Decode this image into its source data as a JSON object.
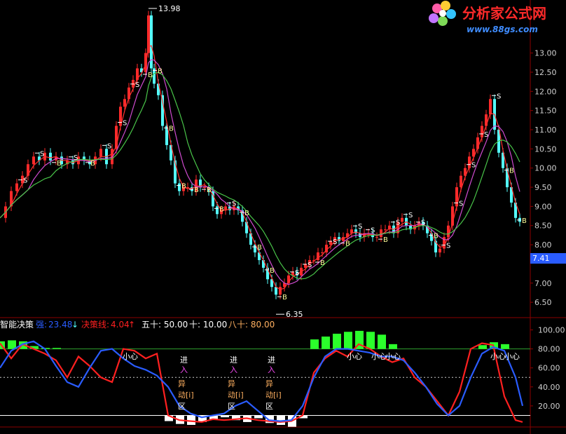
{
  "logo": {
    "name": "分析家公式网",
    "url": "www.88gs.com"
  },
  "colors": {
    "background": "#000000",
    "axis": "#8b0000",
    "up": "#ff2a2a",
    "down": "#54ffff",
    "ma_fast": "#ff3030",
    "ma_mid": "#d04bd0",
    "ma_slow": "#49c449",
    "osc_red": "#ff2020",
    "osc_blue": "#2a5cff",
    "hist_green": "#2bff2b",
    "label_yellow": "#ffff9a",
    "label_white": "#ffffff",
    "text_orange": "#ffb060",
    "text_pink": "#ff4cff"
  },
  "price_axis": {
    "ticks": [
      "13.00",
      "12.50",
      "12.00",
      "11.50",
      "11.00",
      "10.50",
      "10.00",
      "9.50",
      "9.00",
      "8.50",
      "8.00",
      "7.00",
      "6.50"
    ],
    "current_price": "7.41"
  },
  "annotations": {
    "high": "13.98",
    "low": "6.35"
  },
  "chart_data": [
    {
      "type": "line",
      "title": "",
      "ylim": [
        6.1,
        14.2
      ],
      "x": [
        0,
        8,
        16,
        24,
        32,
        40,
        48,
        56,
        64,
        72,
        80,
        88,
        96,
        104,
        112,
        120,
        128,
        136,
        144,
        152,
        160,
        166,
        172,
        178,
        184,
        190,
        196,
        202,
        208,
        212,
        216,
        220,
        226,
        232,
        238,
        244,
        250,
        256,
        262,
        268,
        274,
        280,
        286,
        292,
        298,
        304,
        310,
        316,
        322,
        328,
        334,
        340,
        346,
        352,
        358,
        364,
        370,
        376,
        382,
        388,
        394,
        400,
        406,
        412,
        418,
        424,
        430,
        436,
        442,
        448,
        454,
        460,
        466,
        472,
        478,
        484,
        490,
        496,
        502,
        508,
        514,
        520,
        526,
        532,
        538,
        544,
        550,
        556,
        562,
        568,
        574,
        580,
        586,
        592,
        598,
        604,
        610,
        616,
        622,
        628,
        634,
        640,
        646,
        652,
        658,
        664,
        670,
        676,
        682,
        688,
        694,
        700,
        706,
        712,
        718,
        724,
        730,
        736,
        742,
        748,
        754
      ],
      "series": [
        {
          "name": "",
          "values": [
            8.7,
            9.0,
            9.4,
            9.6,
            9.8,
            10.1,
            10.3,
            10.2,
            10.4,
            10.2,
            10.3,
            10.1,
            10.2,
            10.1,
            10.3,
            10.2,
            10.1,
            10.3,
            10.5,
            10.1,
            10.5,
            11.1,
            11.6,
            11.8,
            12.1,
            12.3,
            12.6,
            12.5,
            13.0,
            13.98,
            12.6,
            12.2,
            11.9,
            11.1,
            10.6,
            10.2,
            9.6,
            9.4,
            9.5,
            9.5,
            9.4,
            9.7,
            9.5,
            9.5,
            9.4,
            9.0,
            8.8,
            8.9,
            9.0,
            8.9,
            9.0,
            8.9,
            8.6,
            8.3,
            8.0,
            7.8,
            7.6,
            7.4,
            7.1,
            6.9,
            6.7,
            6.9,
            7.0,
            7.2,
            7.3,
            7.2,
            7.4,
            7.5,
            7.6,
            7.6,
            7.8,
            7.8,
            8.0,
            8.1,
            8.2,
            8.1,
            8.2,
            8.3,
            8.4,
            8.3,
            8.2,
            8.3,
            8.3,
            8.2,
            8.2,
            8.4,
            8.4,
            8.5,
            8.3,
            8.6,
            8.7,
            8.5,
            8.4,
            8.5,
            8.6,
            8.5,
            8.3,
            8.1,
            7.8,
            7.9,
            8.2,
            8.5,
            9.0,
            9.5,
            9.8,
            10.0,
            10.3,
            10.5,
            10.8,
            11.1,
            11.4,
            11.8,
            11.0,
            10.4,
            10.0,
            9.5,
            9.1,
            8.7,
            8.6
          ]
        }
      ]
    },
    {
      "type": "line",
      "title": "",
      "ylim": [
        0,
        110
      ],
      "ticks": [
        "100.00",
        "80.00",
        "60.00",
        "40.00",
        "20.00"
      ],
      "x": [
        0,
        16,
        32,
        48,
        64,
        80,
        96,
        112,
        128,
        144,
        160,
        176,
        192,
        208,
        224,
        240,
        256,
        272,
        288,
        304,
        320,
        336,
        352,
        368,
        384,
        400,
        416,
        432,
        448,
        464,
        480,
        496,
        512,
        528,
        544,
        560,
        576,
        592,
        608,
        624,
        640,
        656,
        672,
        688,
        704,
        720,
        736,
        746
      ],
      "series": [
        {
          "name": "",
          "values": [
            86,
            70,
            85,
            80,
            75,
            68,
            50,
            72,
            62,
            50,
            45,
            80,
            78,
            70,
            75,
            10,
            5,
            4,
            3,
            6,
            5,
            6,
            7,
            5,
            4,
            3,
            4,
            10,
            55,
            70,
            78,
            72,
            85,
            80,
            72,
            66,
            70,
            50,
            40,
            25,
            10,
            35,
            80,
            86,
            84,
            30,
            5,
            3
          ]
        },
        {
          "name": "",
          "values": [
            60,
            78,
            85,
            88,
            80,
            62,
            45,
            40,
            60,
            78,
            80,
            70,
            62,
            58,
            52,
            40,
            20,
            12,
            8,
            10,
            12,
            20,
            25,
            15,
            5,
            4,
            5,
            20,
            50,
            72,
            80,
            80,
            78,
            76,
            72,
            72,
            68,
            55,
            40,
            22,
            10,
            20,
            50,
            75,
            82,
            78,
            50,
            20
          ]
        }
      ],
      "histogram": [
        8,
        9,
        8,
        3,
        1,
        1,
        0,
        0,
        0,
        0,
        0,
        0,
        0,
        0,
        0,
        -6,
        -9,
        -10,
        -7,
        -4,
        -2,
        -5,
        -7,
        -3,
        -8,
        -10,
        -12,
        -3,
        10,
        13,
        16,
        18,
        19,
        18,
        15,
        5,
        0,
        0,
        0,
        0,
        0,
        0,
        0,
        4,
        7,
        5,
        0,
        0
      ]
    }
  ],
  "indicator_header": {
    "name": "智能决策",
    "value_label": "强:",
    "value": "23.48",
    "value_arrow": "↓",
    "decision_label": "决策线:",
    "decision_value": "4.04",
    "decision_arrow": "↑",
    "level1": "五十: 50.00",
    "level2": "十: 10.00",
    "level3": "八十: 80.00"
  },
  "signals": {
    "buy": "B",
    "sell": "S",
    "entry_chars": [
      "进",
      "入"
    ],
    "event_chars": [
      "异",
      "动[i]",
      "区"
    ],
    "caution": "小心"
  }
}
